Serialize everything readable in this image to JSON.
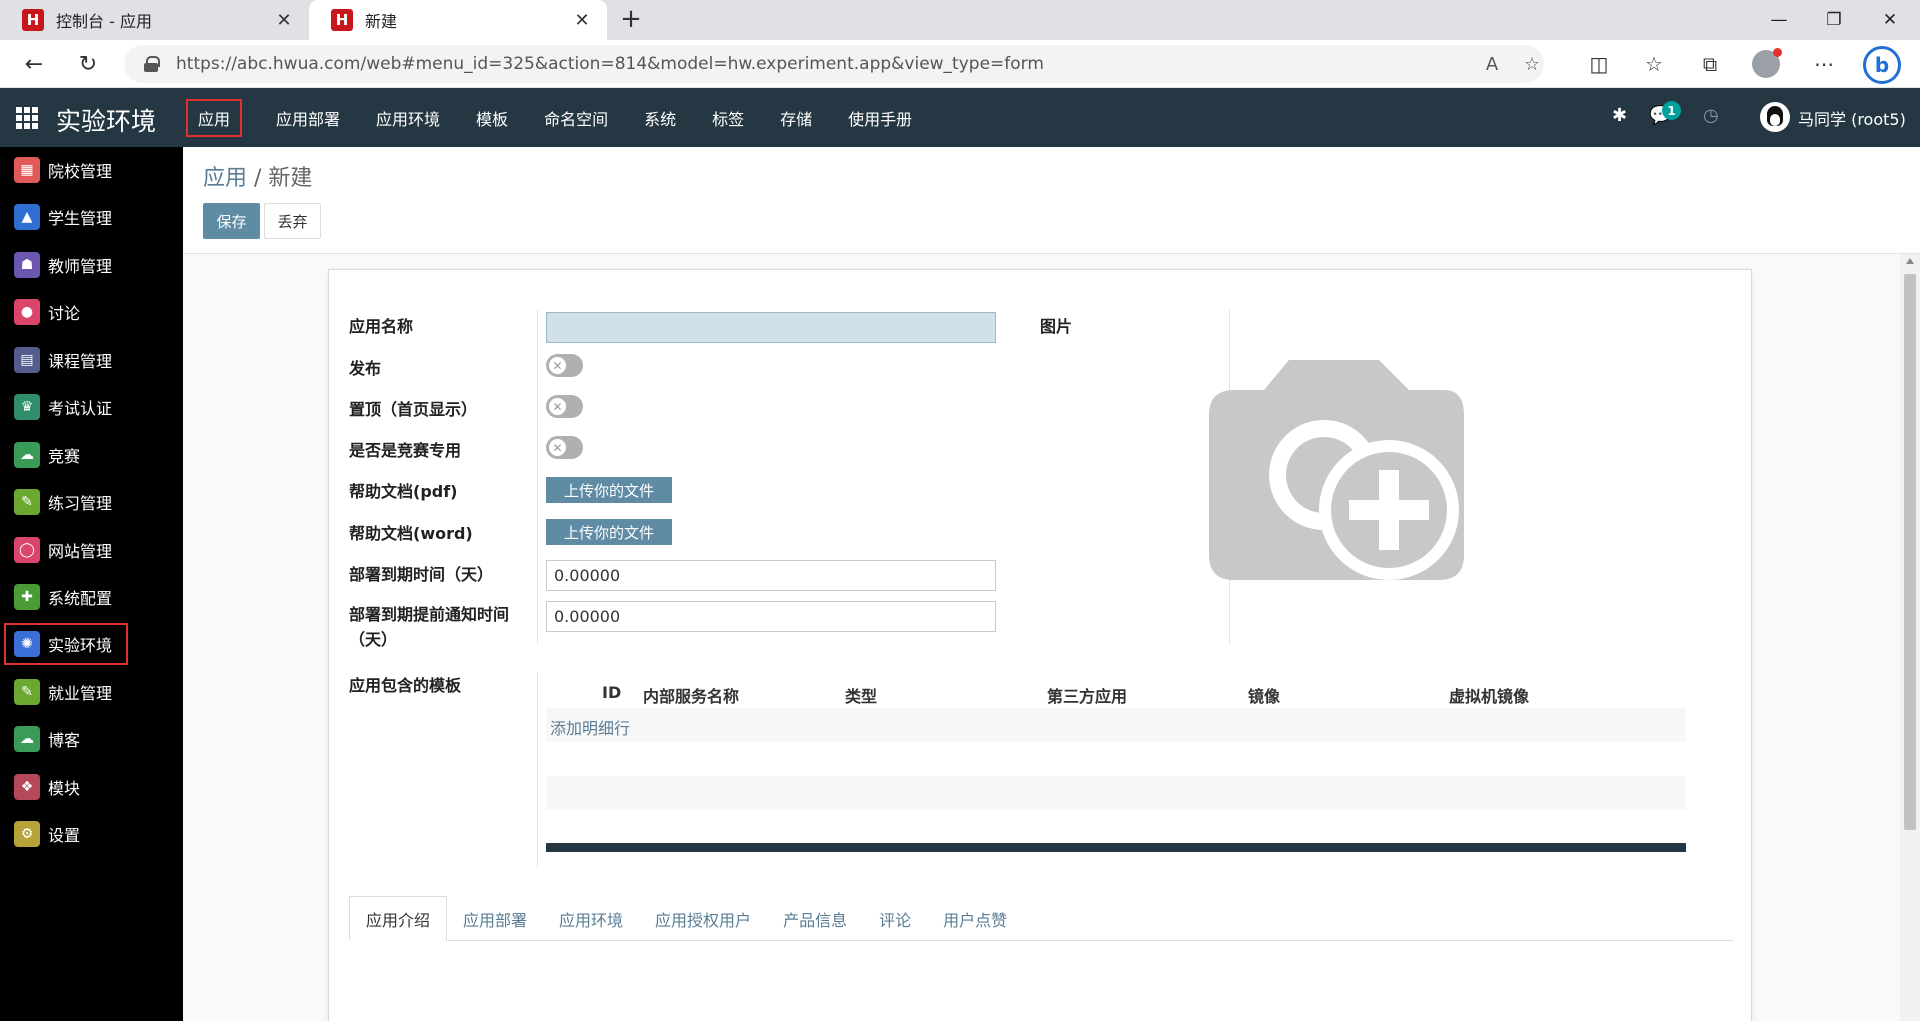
{
  "browser": {
    "tabs": [
      {
        "title": "控制台 - 应用",
        "favicon": "H"
      },
      {
        "title": "新建",
        "favicon": "H"
      }
    ],
    "url": "https://abc.hwua.com/web#menu_id=325&action=814&model=hw.experiment.app&view_type=form"
  },
  "navbar": {
    "brand": "实验环境",
    "menu": [
      "应用",
      "应用部署",
      "应用环境",
      "模板",
      "命名空间",
      "系统",
      "标签",
      "存储",
      "使用手册"
    ],
    "message_count": "1",
    "user": "马同学 (root5)"
  },
  "sidebar": {
    "items": [
      {
        "label": "院校管理",
        "icon": "building-icon",
        "color": "#e05a5a"
      },
      {
        "label": "学生管理",
        "icon": "graduation-cap-icon",
        "color": "#2f6fd1"
      },
      {
        "label": "教师管理",
        "icon": "teacher-icon",
        "color": "#6b57b0"
      },
      {
        "label": "讨论",
        "icon": "chat-bubble-icon",
        "color": "#d9456b"
      },
      {
        "label": "课程管理",
        "icon": "course-grid-icon",
        "color": "#555d8e"
      },
      {
        "label": "考试认证",
        "icon": "trophy-icon",
        "color": "#2f8f6a"
      },
      {
        "label": "竞赛",
        "icon": "cloud-icon",
        "color": "#3a9a58"
      },
      {
        "label": "练习管理",
        "icon": "exercise-icon",
        "color": "#6aa82f"
      },
      {
        "label": "网站管理",
        "icon": "globe-ring-icon",
        "color": "#d9456b"
      },
      {
        "label": "系统配置",
        "icon": "wrench-icon",
        "color": "#4a9a35"
      },
      {
        "label": "实验环境",
        "icon": "helm-icon",
        "color": "#3b6fd8"
      },
      {
        "label": "就业管理",
        "icon": "employment-icon",
        "color": "#6aa82f"
      },
      {
        "label": "博客",
        "icon": "cloud-icon",
        "color": "#3a9a58"
      },
      {
        "label": "模块",
        "icon": "modules-icon",
        "color": "#b5485a"
      },
      {
        "label": "设置",
        "icon": "gear-icon",
        "color": "#b8a23a"
      }
    ]
  },
  "page": {
    "breadcrumb_parent": "应用",
    "breadcrumb_sep": " / ",
    "breadcrumb_current": "新建",
    "save_label": "保存",
    "discard_label": "丢弃"
  },
  "form": {
    "labels": {
      "name": "应用名称",
      "publish": "发布",
      "pin_top": "置顶（首页显示）",
      "competition_only": "是否是竞赛专用",
      "help_pdf": "帮助文档(pdf)",
      "help_word": "帮助文档(word)",
      "deploy_expiry": "部署到期时间（天）",
      "notify_before": "部署到期提前通知时间（天）",
      "image": "图片",
      "templates": "应用包含的模板"
    },
    "values": {
      "name": "",
      "publish": false,
      "pin_top": false,
      "competition_only": false,
      "deploy_expiry": "0.00000",
      "notify_before": "0.00000"
    },
    "upload_label": "上传你的文件",
    "template_columns": [
      "ID",
      "内部服务名称",
      "类型",
      "第三方应用",
      "镜像",
      "虚拟机镜像"
    ],
    "add_line": "添加明细行",
    "notebook_tabs": [
      "应用介绍",
      "应用部署",
      "应用环境",
      "应用授权用户",
      "产品信息",
      "评论",
      "用户点赞"
    ]
  }
}
